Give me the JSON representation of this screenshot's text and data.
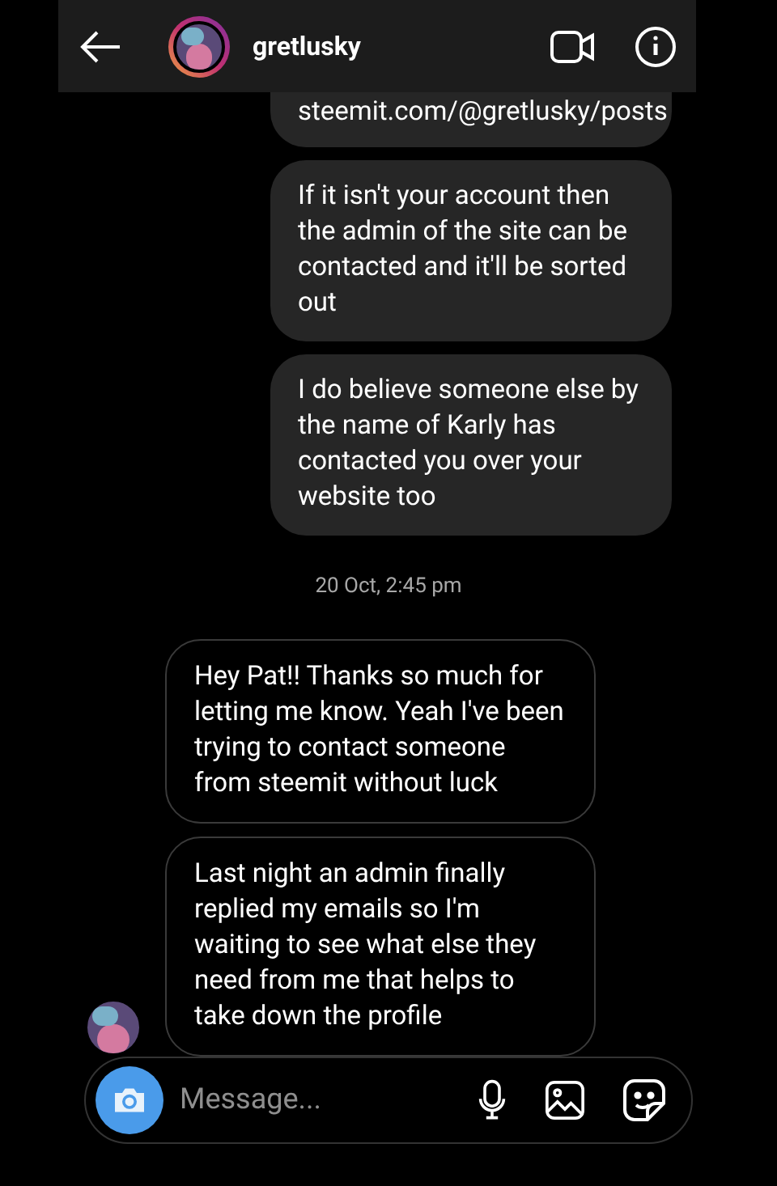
{
  "header": {
    "username": "gretlusky"
  },
  "messages": [
    {
      "kind": "sent",
      "text": "steemit.com/@gretlusky/posts",
      "cut": true
    },
    {
      "kind": "sent",
      "text": "If it isn't your account then the admin of the site can be contacted and it'll be sorted out"
    },
    {
      "kind": "sent",
      "text": "I do believe someone else by the name of Karly has contacted you over your website too"
    },
    {
      "kind": "date",
      "text": "20 Oct, 2:45 pm"
    },
    {
      "kind": "received",
      "text": "Hey Pat!! Thanks so much for letting me know. Yeah I've been trying to contact someone from steemit without luck"
    },
    {
      "kind": "received",
      "text": "Last night an admin finally replied my emails so I'm waiting to see what else they need from me that helps to take down the profile",
      "avatar": true
    }
  ],
  "composer": {
    "placeholder": "Message..."
  }
}
